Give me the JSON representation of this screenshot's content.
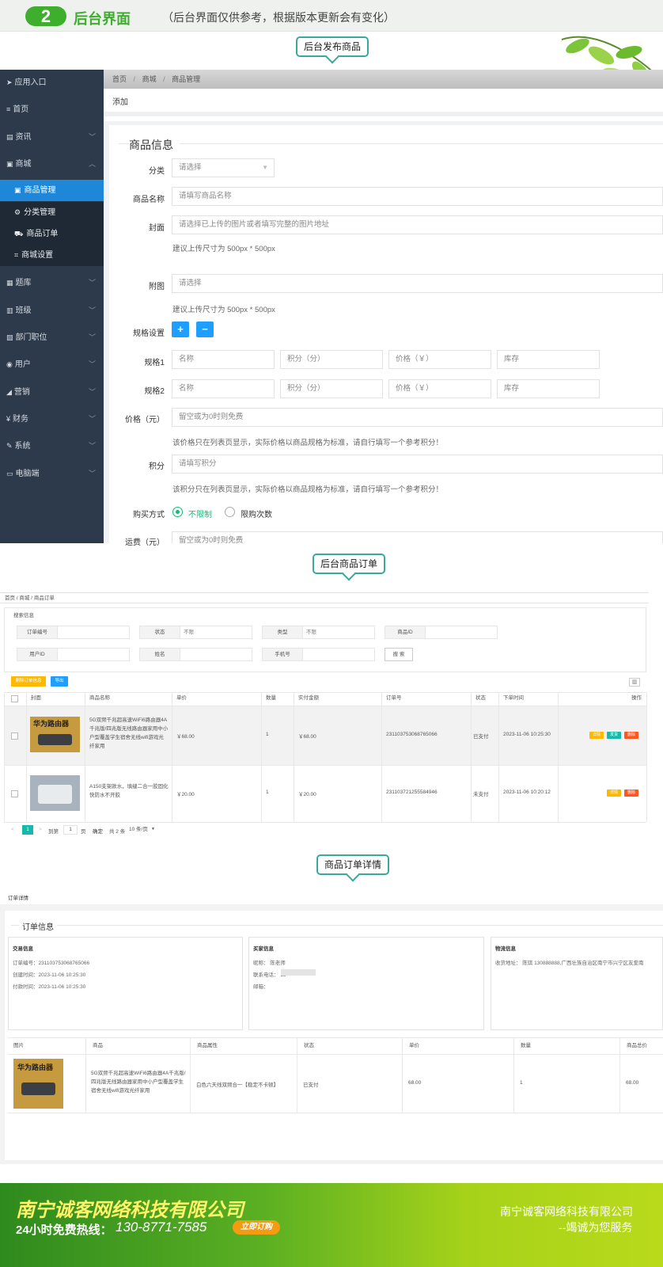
{
  "banner": {
    "number": "2",
    "title": "后台界面",
    "subtitle": "（后台界面仅供参考，根据版本更新会有变化）"
  },
  "callouts": {
    "publish": "后台发布商品",
    "orders": "后台商品订单",
    "detail": "商品订单详情"
  },
  "sidebar": {
    "items": [
      {
        "icon": "send-icon",
        "glyph": "➤",
        "label": "应用入口"
      },
      {
        "icon": "menu-icon",
        "glyph": "≡",
        "label": "首页"
      },
      {
        "icon": "news-icon",
        "glyph": "▤",
        "label": "资讯"
      },
      {
        "icon": "mall-icon",
        "glyph": "▣",
        "label": "商城"
      },
      {
        "icon": "bank-icon",
        "glyph": "▦",
        "label": "题库"
      },
      {
        "icon": "class-icon",
        "glyph": "▥",
        "label": "班级"
      },
      {
        "icon": "dept-icon",
        "glyph": "▨",
        "label": "部门职位"
      },
      {
        "icon": "user-icon",
        "glyph": "◉",
        "label": "用户"
      },
      {
        "icon": "marketing-icon",
        "glyph": "◢",
        "label": "营销"
      },
      {
        "icon": "finance-icon",
        "glyph": "¥",
        "label": "财务"
      },
      {
        "icon": "wrench-icon",
        "glyph": "✎",
        "label": "系统"
      },
      {
        "icon": "laptop-icon",
        "glyph": "▭",
        "label": "电脑端"
      }
    ],
    "sub_items": [
      {
        "icon": "goods-icon",
        "glyph": "▣",
        "label": "商品管理"
      },
      {
        "icon": "gears-icon",
        "glyph": "⚙",
        "label": "分类管理"
      },
      {
        "icon": "cart-icon",
        "glyph": "⛟",
        "label": "商品订单"
      },
      {
        "icon": "crop-icon",
        "glyph": "⌗",
        "label": "商城设置"
      }
    ]
  },
  "publish": {
    "breadcrumb": [
      "首页",
      "商城",
      "商品管理"
    ],
    "subhead": "添加",
    "fieldset": "商品信息",
    "category_label": "分类",
    "category_value": "请选择",
    "name_label": "商品名称",
    "name_placeholder": "请填写商品名称",
    "cover_label": "封面",
    "cover_placeholder": "请选择已上传的图片或者填写完整的图片地址",
    "size_hint": "建议上传尺寸为 500px * 500px",
    "attach_label": "附图",
    "attach_placeholder": "请选择",
    "spec_label": "规格设置",
    "plus": "+",
    "minus": "−",
    "spec1_label": "规格1",
    "spec2_label": "规格2",
    "spec_fields": [
      "名称",
      "积分（分）",
      "价格（￥）",
      "库存"
    ],
    "price_label": "价格（元）",
    "price_placeholder": "留空或为0时则免费",
    "price_hint": "该价格只在列表页显示，实际价格以商品规格为标准，请自行填写一个参考积分！",
    "points_label": "积分",
    "points_placeholder": "请填写积分",
    "points_hint": "该积分只在列表页显示，实际价格以商品规格为标准，请自行填写一个参考积分！",
    "buy_label": "购买方式",
    "buy_opt1": "不限制",
    "buy_opt2": "限购次数",
    "freight_label": "运费（元）",
    "freight_placeholder": "留空或为0时则免费"
  },
  "orders": {
    "breadcrumb": "首页  /  商城  /  商品订单",
    "search_title": "搜索信息",
    "search_fields": [
      {
        "label": "订单编号",
        "value": ""
      },
      {
        "label": "状态",
        "value": "不限"
      },
      {
        "label": "类型",
        "value": "不限"
      },
      {
        "label": "商品ID",
        "value": ""
      },
      {
        "label": "用户ID",
        "value": ""
      },
      {
        "label": "姓名",
        "value": ""
      },
      {
        "label": "手机号",
        "value": ""
      }
    ],
    "search_btn": "搜 索",
    "btn_delete": "删除订单信息",
    "btn_export": "导出",
    "columns": [
      "封面",
      "商品名称",
      "单价",
      "数量",
      "实付金额",
      "订单号",
      "状态",
      "下单时间",
      "操作"
    ],
    "rows": [
      {
        "name": "5G双频千兆超高速WiFi6路由器4A千兆版/四兆版无线路由器家用中小户型覆盖学生宿舍无线wifi游戏光纤家用",
        "price": "￥68.00",
        "qty": "1",
        "paid": "￥68.00",
        "order_no": "23110375306876​5066",
        "status": "已支付",
        "time": "2023-11-06 10:25:30",
        "img_text": "华为路由器",
        "actions": [
          "详情",
          "发货",
          "删除"
        ]
      },
      {
        "name": "A150支架款水，填缝二合一胶固化快防水不开胶",
        "price": "￥20.00",
        "qty": "1",
        "paid": "￥20.00",
        "order_no": "231103721255584946",
        "status": "未支付",
        "time": "2023-11-06 10:20:12",
        "img_text": "",
        "actions": [
          "详情",
          "删除"
        ]
      }
    ],
    "pager": {
      "prev": "<",
      "page": "1",
      "next": ">",
      "goto": "到第",
      "goto_val": "1",
      "page_unit": "页",
      "confirm": "确定",
      "total": "共 2 条",
      "per_page": "10 条/页"
    }
  },
  "detail": {
    "subhead": "订单详情",
    "fieldset": "订单信息",
    "trade": {
      "title": "交易信息",
      "lines": [
        "订单编号：231103753068765066",
        "创建时间：2023-11-06 10:25:30",
        "付款时间：2023-11-06 10:25:30"
      ]
    },
    "buyer": {
      "title": "买家信息",
      "lines": [
        "昵称：  陈老师",
        "联系电话：  13",
        "邮箱："
      ]
    },
    "logistics": {
      "title": "物流信息",
      "lines": [
        "收货地址：  陈琪 130888888,广西壮族自治区南宁市兴宁区友爱南"
      ]
    },
    "columns": [
      "图片",
      "商品",
      "商品属性",
      "状态",
      "单价",
      "数量",
      "商品总价"
    ],
    "row": {
      "name": "5G双频千兆超高速WiFi6路由器4A千兆版/四兆版无线路由器家用中小户型覆盖学生宿舍无线wifi游戏光纤家用",
      "attr": "白色六天线双频合一【稳定不卡顿】",
      "status": "已支付",
      "price": "68.00",
      "qty": "1",
      "total": "68.00",
      "img_text": "华为路由器"
    }
  },
  "footer": {
    "company": "南宁诚客网络科技有限公司",
    "hotline_label": "24小时免费热线：",
    "hotline": "130-8771-7585",
    "btn": "立即订购",
    "right_company": "南宁诚客网络科技有限公司",
    "slogan": "--竭诚为您服务"
  },
  "colors": {
    "accent": "#1e9fff",
    "green": "#3eae2d",
    "sidebar": "#2d3a4b",
    "teal": "#3aa89c"
  }
}
